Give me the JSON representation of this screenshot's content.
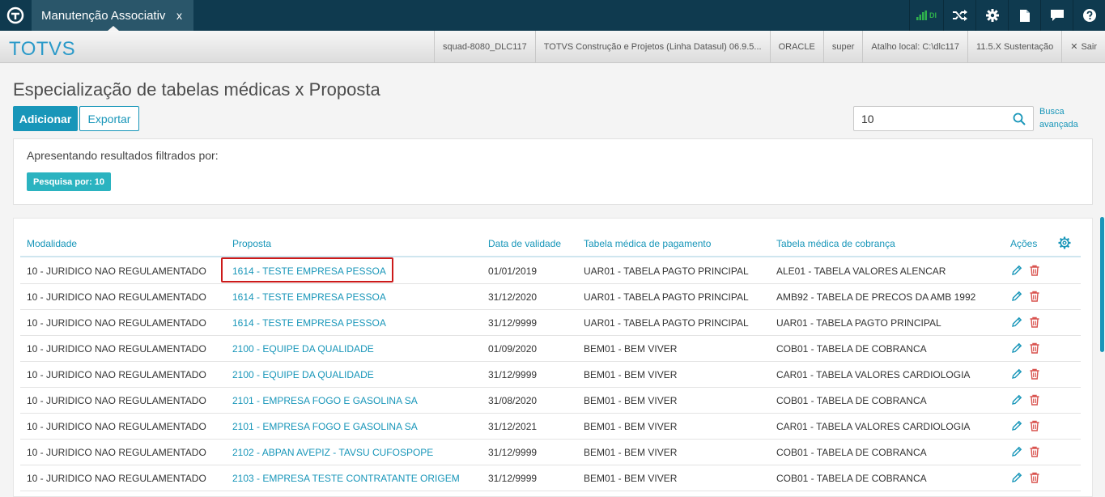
{
  "topbar": {
    "tab_label": "Manutenção Associativ",
    "tab_close": "x",
    "signal_label": "DI",
    "icons": [
      "signal-icon",
      "shuffle-icon",
      "gear-icon",
      "document-icon",
      "chat-icon",
      "help-icon"
    ]
  },
  "header": {
    "brand": "TOTVS",
    "cells": [
      "squad-8080_DLC117",
      "TOTVS Construção e Projetos (Linha Datasul) 06.9.5...",
      "ORACLE",
      "super",
      "Atalho local: C:\\dlc117",
      "11.5.X Sustentação"
    ],
    "logout": "Sair"
  },
  "page": {
    "title": "Especialização de tabelas médicas x Proposta",
    "add_label": "Adicionar",
    "export_label": "Exportar",
    "search_value": "10",
    "advanced_search_line1": "Busca",
    "advanced_search_line2": "avançada"
  },
  "filter": {
    "title": "Apresentando resultados filtrados por:",
    "chip": "Pesquisa por: 10"
  },
  "table": {
    "headers": {
      "modalidade": "Modalidade",
      "proposta": "Proposta",
      "data": "Data de validade",
      "pagamento": "Tabela médica de pagamento",
      "cobranca": "Tabela médica de cobrança",
      "acoes": "Ações"
    },
    "rows": [
      {
        "modalidade": "10 - JURIDICO NAO REGULAMENTADO",
        "proposta": "1614 - TESTE EMPRESA PESSOA",
        "data": "01/01/2019",
        "pagamento": "UAR01 - TABELA PAGTO PRINCIPAL",
        "cobranca": "ALE01 - TABELA VALORES ALENCAR"
      },
      {
        "modalidade": "10 - JURIDICO NAO REGULAMENTADO",
        "proposta": "1614 - TESTE EMPRESA PESSOA",
        "data": "31/12/2020",
        "pagamento": "UAR01 - TABELA PAGTO PRINCIPAL",
        "cobranca": "AMB92 - TABELA DE PRECOS DA AMB 1992"
      },
      {
        "modalidade": "10 - JURIDICO NAO REGULAMENTADO",
        "proposta": "1614 - TESTE EMPRESA PESSOA",
        "data": "31/12/9999",
        "pagamento": "UAR01 - TABELA PAGTO PRINCIPAL",
        "cobranca": "UAR01 - TABELA PAGTO PRINCIPAL"
      },
      {
        "modalidade": "10 - JURIDICO NAO REGULAMENTADO",
        "proposta": "2100 - EQUIPE DA QUALIDADE",
        "data": "01/09/2020",
        "pagamento": "BEM01 - BEM VIVER",
        "cobranca": "COB01 - TABELA DE COBRANCA"
      },
      {
        "modalidade": "10 - JURIDICO NAO REGULAMENTADO",
        "proposta": "2100 - EQUIPE DA QUALIDADE",
        "data": "31/12/9999",
        "pagamento": "BEM01 - BEM VIVER",
        "cobranca": "CAR01 - TABELA VALORES CARDIOLOGIA"
      },
      {
        "modalidade": "10 - JURIDICO NAO REGULAMENTADO",
        "proposta": "2101 - EMPRESA FOGO E GASOLINA SA",
        "data": "31/08/2020",
        "pagamento": "BEM01 - BEM VIVER",
        "cobranca": "COB01 - TABELA DE COBRANCA"
      },
      {
        "modalidade": "10 - JURIDICO NAO REGULAMENTADO",
        "proposta": "2101 - EMPRESA FOGO E GASOLINA SA",
        "data": "31/12/2021",
        "pagamento": "BEM01 - BEM VIVER",
        "cobranca": "CAR01 - TABELA VALORES CARDIOLOGIA"
      },
      {
        "modalidade": "10 - JURIDICO NAO REGULAMENTADO",
        "proposta": "2102 - ABPAN AVEPIZ - TAVSU CUFOSPOPE",
        "data": "31/12/9999",
        "pagamento": "BEM01 - BEM VIVER",
        "cobranca": "COB01 - TABELA DE COBRANCA"
      },
      {
        "modalidade": "10 - JURIDICO NAO REGULAMENTADO",
        "proposta": "2103 - EMPRESA TESTE CONTRATANTE ORIGEM",
        "data": "31/12/9999",
        "pagamento": "BEM01 - BEM VIVER",
        "cobranca": "COB01 - TABELA DE COBRANCA"
      }
    ]
  },
  "colors": {
    "accent": "#1896b9",
    "topbar": "#0f3a4f",
    "chip": "#2bb3c0",
    "delete": "#d9534f",
    "highlight": "#cc1a1a"
  }
}
